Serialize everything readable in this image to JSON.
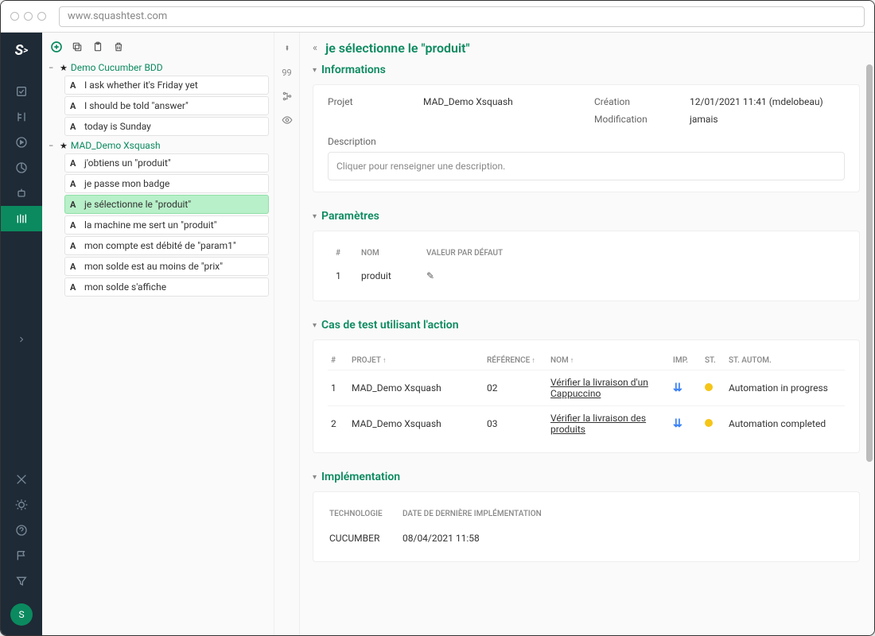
{
  "browser": {
    "url": "www.squashtest.com"
  },
  "sidebar": {
    "avatar_initial": "S"
  },
  "tree": {
    "projects": [
      {
        "name": "Demo Cucumber BDD",
        "items": [
          {
            "type": "A",
            "label": "I ask whether it's Friday yet"
          },
          {
            "type": "A",
            "label": "I should be told \"answer\""
          },
          {
            "type": "A",
            "label": "today is Sunday"
          }
        ]
      },
      {
        "name": "MAD_Demo Xsquash",
        "items": [
          {
            "type": "A",
            "label": "j'obtiens un \"produit\""
          },
          {
            "type": "A",
            "label": "je passe mon badge"
          },
          {
            "type": "A",
            "label": "je sélectionne le \"produit\"",
            "selected": true
          },
          {
            "type": "A",
            "label": "la machine me sert un \"produit\""
          },
          {
            "type": "A",
            "label": "mon compte est débité de \"param1\""
          },
          {
            "type": "A",
            "label": "mon solde est au moins de \"prix\""
          },
          {
            "type": "A",
            "label": "mon solde s'affiche"
          }
        ]
      }
    ]
  },
  "rail": {
    "badge": "99"
  },
  "main": {
    "title": "je sélectionne le \"produit\"",
    "informations": {
      "heading": "Informations",
      "projet_label": "Projet",
      "projet_value": "MAD_Demo Xsquash",
      "creation_label": "Création",
      "creation_value": "12/01/2021 11:41 (mdelobeau)",
      "modification_label": "Modification",
      "modification_value": "jamais",
      "description_label": "Description",
      "description_placeholder": "Cliquer pour renseigner une description."
    },
    "parametres": {
      "heading": "Paramètres",
      "col_num": "#",
      "col_nom": "Nom",
      "col_valeur": "Valeur par défaut",
      "rows": [
        {
          "num": "1",
          "nom": "produit"
        }
      ]
    },
    "cas_de_test": {
      "heading": "Cas de test utilisant l'action",
      "col_num": "#",
      "col_projet": "Projet",
      "col_reference": "Référence",
      "col_nom": "Nom",
      "col_imp": "Imp.",
      "col_st": "St.",
      "col_st_autom": "St. autom.",
      "rows": [
        {
          "num": "1",
          "projet": "MAD_Demo Xsquash",
          "reference": "02",
          "nom": "Vérifier la livraison d'un Cappuccino",
          "st_autom": "Automation in progress"
        },
        {
          "num": "2",
          "projet": "MAD_Demo Xsquash",
          "reference": "03",
          "nom": "Vérifier la livraison des produits",
          "st_autom": "Automation completed"
        }
      ]
    },
    "implementation": {
      "heading": "Implémentation",
      "col_technologie": "Technologie",
      "col_date": "Date de dernière implémentation",
      "rows": [
        {
          "technologie": "CUCUMBER",
          "date": "08/04/2021 11:58"
        }
      ]
    }
  }
}
